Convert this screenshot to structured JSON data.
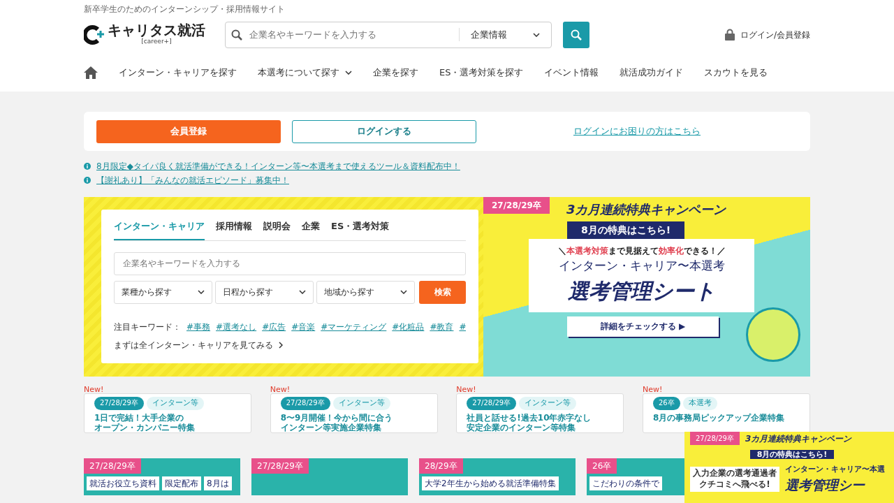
{
  "header": {
    "tagline": "新卒学生のためのインターンシップ・採用情報サイト",
    "logo": {
      "text": "キャリタス就活",
      "sub": "[career+]"
    },
    "search": {
      "placeholder": "企業名やキーワードを入力する",
      "category": "企業情報"
    },
    "login": "ログイン/会員登録"
  },
  "nav": [
    {
      "label": "インターン・キャリアを探す",
      "has_dropdown": false
    },
    {
      "label": "本選考について探す",
      "has_dropdown": true
    },
    {
      "label": "企業を探す",
      "has_dropdown": false
    },
    {
      "label": "ES・選考対策を探す",
      "has_dropdown": false
    },
    {
      "label": "イベント情報",
      "has_dropdown": false
    },
    {
      "label": "就活成功ガイド",
      "has_dropdown": false
    },
    {
      "label": "スカウトを見る",
      "has_dropdown": false
    }
  ],
  "auth": {
    "register": "会員登録",
    "login": "ログインする",
    "help": "ログインにお困りの方はこちら"
  },
  "notices": [
    "8月限定◆タイパ良く就活準備ができる！インターン等〜本選考まで使えるツール＆資料配布中！",
    "【謝礼あり】「みんなの就活エピソード」募集中！"
  ],
  "search_panel": {
    "tabs": [
      {
        "label": "インターン・キャリア",
        "selected": true
      },
      {
        "label": "採用情報",
        "selected": false
      },
      {
        "label": "説明会",
        "selected": false
      },
      {
        "label": "企業",
        "selected": false
      },
      {
        "label": "ES・選考対策",
        "selected": false
      }
    ],
    "placeholder": "企業名やキーワードを入力する",
    "selects": [
      "業種から探す",
      "日程から探す",
      "地域から探す"
    ],
    "submit": "検索",
    "keywords_label": "注目キーワード：",
    "keywords": [
      "#事務",
      "#選考なし",
      "#広告",
      "#音楽",
      "#マーケティング",
      "#化粧品",
      "#教育",
      "#"
    ],
    "all_link": "まずは全インターン・キャリアを見てみる"
  },
  "campaign_banner": {
    "tag": "27/28/29卒",
    "title": "3カ月連続特典キャンペーン",
    "ribbon": "8月の特典はこちら!",
    "catch": "＼**本選考対策**まで見据えて**効率化**できる！／",
    "subtitle": "インターン・キャリア〜本選考",
    "headline": "選考管理シート",
    "button": "詳細をチェックする ▶"
  },
  "features": [
    {
      "new": "New!",
      "tags": [
        "27/28/29卒",
        "インターン等"
      ],
      "title_lines": [
        "1日で完結！大手企業の",
        "オープン・カンパニー特集"
      ]
    },
    {
      "new": "New!",
      "tags": [
        "27/28/29卒",
        "インターン等"
      ],
      "title_lines": [
        "8〜9月開催！今から間に合う",
        "インターン等実施企業特集"
      ]
    },
    {
      "new": "New!",
      "tags": [
        "27/28/29卒",
        "インターン等"
      ],
      "title_lines": [
        "社員と話せる!過去10年赤字なし",
        "安定企業のインターン等特集"
      ]
    },
    {
      "new": "New!",
      "tags": [
        "26卒",
        "本選考"
      ],
      "title_lines": [
        "8月の事務局ピックアップ企業特集"
      ]
    }
  ],
  "thumbnails": [
    {
      "tag": "27/28/29卒",
      "texts": [
        "就活お役立ち資料",
        "限定配布",
        "8月は"
      ]
    },
    {
      "tag": "27/28/29卒"
    },
    {
      "tag": "28/29卒",
      "texts": [
        "大学2年生から始める就活準備特集"
      ]
    },
    {
      "tag": "26卒",
      "texts": [
        "こだわりの条件で"
      ]
    }
  ],
  "floating_banner": {
    "tag": "27/28/29卒",
    "title": "3カ月連続特典キャンペーン",
    "ribbon": "8月の特典はこちら!",
    "catch_lines": [
      "入力企業の選考通過者",
      "クチコミへ飛べる!"
    ],
    "subtitle": "インターン・キャリア〜本選",
    "headline": "選考管理シー"
  }
}
